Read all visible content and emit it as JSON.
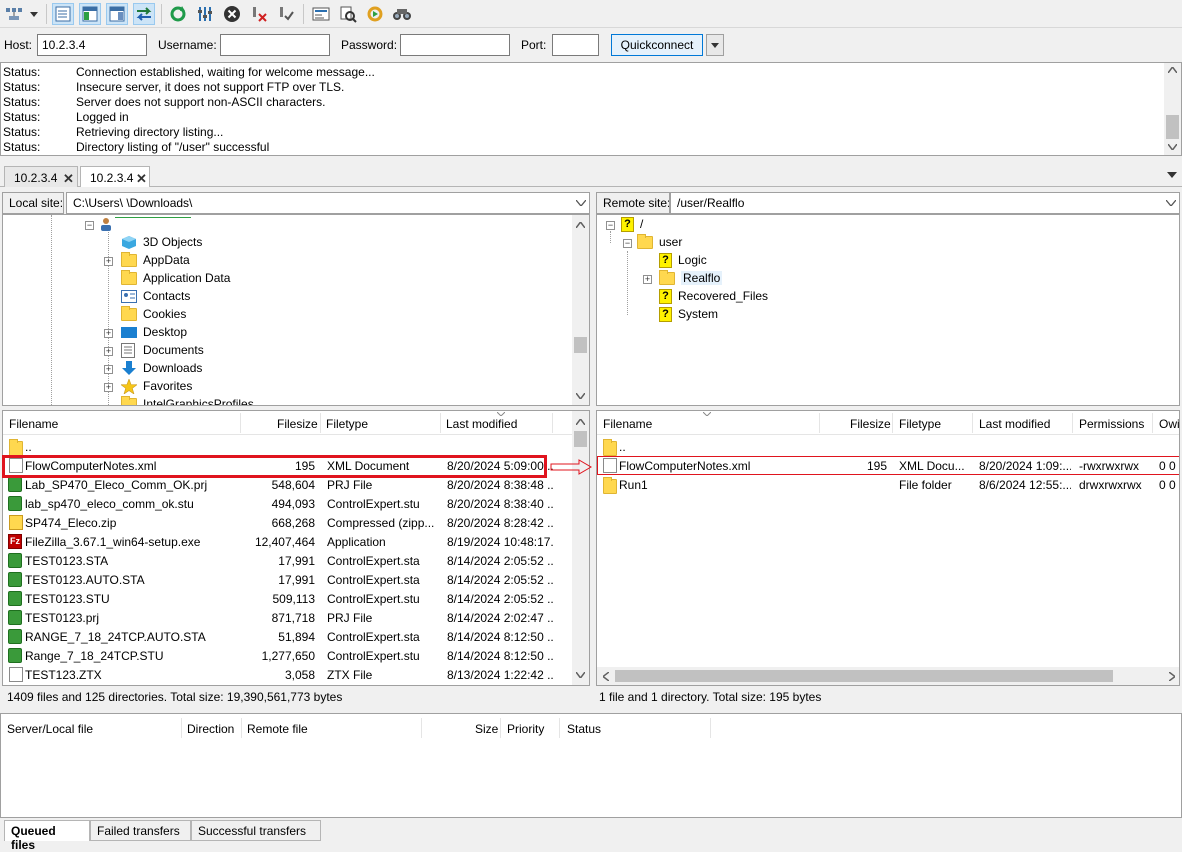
{
  "toolbar": {
    "icons": [
      "site-manager-icon",
      "dropdown-arrow-icon",
      "toggle-message-log-icon",
      "toggle-local-tree-icon",
      "toggle-remote-tree-icon",
      "toggle-transfer-queue-icon",
      "refresh-icon",
      "process-queue-icon",
      "cancel-icon",
      "disconnect-icon",
      "reconnect-icon",
      "directory-filter-icon",
      "compare-icon",
      "sync-browse-icon",
      "search-icon"
    ]
  },
  "quickconnect": {
    "host_label": "Host:",
    "host_value": "10.2.3.4",
    "username_label": "Username:",
    "username_value": "",
    "password_label": "Password:",
    "password_value": "",
    "port_label": "Port:",
    "port_value": "",
    "button_label": "Quickconnect"
  },
  "log": [
    {
      "label": "Status:",
      "text": "Connection established, waiting for welcome message..."
    },
    {
      "label": "Status:",
      "text": "Insecure server, it does not support FTP over TLS."
    },
    {
      "label": "Status:",
      "text": "Server does not support non-ASCII characters."
    },
    {
      "label": "Status:",
      "text": "Logged in"
    },
    {
      "label": "Status:",
      "text": "Retrieving directory listing..."
    },
    {
      "label": "Status:",
      "text": "Directory listing of \"/user\" successful"
    }
  ],
  "tabs": [
    {
      "label": "10.2.3.4"
    },
    {
      "label": "10.2.3.4"
    }
  ],
  "local": {
    "site_label": "Local site:",
    "path": "C:\\Users\\               \\Downloads\\",
    "tree": [
      {
        "label": "3D Objects"
      },
      {
        "label": "AppData"
      },
      {
        "label": "Application Data"
      },
      {
        "label": "Contacts"
      },
      {
        "label": "Cookies"
      },
      {
        "label": "Desktop"
      },
      {
        "label": "Documents"
      },
      {
        "label": "Downloads"
      },
      {
        "label": "Favorites"
      },
      {
        "label": "IntelGraphicsProfiles"
      }
    ],
    "columns": {
      "filename": "Filename",
      "filesize": "Filesize",
      "filetype": "Filetype",
      "modified": "Last modified"
    },
    "files": [
      {
        "name": "..",
        "size": "",
        "type": "",
        "modified": ""
      },
      {
        "name": "FlowComputerNotes.xml",
        "size": "195",
        "type": "XML Document",
        "modified": "8/20/2024 5:09:00 ..."
      },
      {
        "name": "Lab_SP470_Eleco_Comm_OK.prj",
        "size": "548,604",
        "type": "PRJ File",
        "modified": "8/20/2024 8:38:48 ..."
      },
      {
        "name": "lab_sp470_eleco_comm_ok.stu",
        "size": "494,093",
        "type": "ControlExpert.stu",
        "modified": "8/20/2024 8:38:40 ..."
      },
      {
        "name": "SP474_Eleco.zip",
        "size": "668,268",
        "type": "Compressed (zipp...",
        "modified": "8/20/2024 8:28:42 ..."
      },
      {
        "name": "FileZilla_3.67.1_win64-setup.exe",
        "size": "12,407,464",
        "type": "Application",
        "modified": "8/19/2024 10:48:17..."
      },
      {
        "name": "TEST0123.STA",
        "size": "17,991",
        "type": "ControlExpert.sta",
        "modified": "8/14/2024 2:05:52 ..."
      },
      {
        "name": "TEST0123.AUTO.STA",
        "size": "17,991",
        "type": "ControlExpert.sta",
        "modified": "8/14/2024 2:05:52 ..."
      },
      {
        "name": "TEST0123.STU",
        "size": "509,113",
        "type": "ControlExpert.stu",
        "modified": "8/14/2024 2:05:52 ..."
      },
      {
        "name": "TEST0123.prj",
        "size": "871,718",
        "type": "PRJ File",
        "modified": "8/14/2024 2:02:47 ..."
      },
      {
        "name": "RANGE_7_18_24TCP.AUTO.STA",
        "size": "51,894",
        "type": "ControlExpert.sta",
        "modified": "8/14/2024 8:12:50 ..."
      },
      {
        "name": "Range_7_18_24TCP.STU",
        "size": "1,277,650",
        "type": "ControlExpert.stu",
        "modified": "8/14/2024 8:12:50 ..."
      },
      {
        "name": "TEST123.ZTX",
        "size": "3,058",
        "type": "ZTX File",
        "modified": "8/13/2024 1:22:42 ..."
      }
    ],
    "status": "1409 files and 125 directories. Total size: 19,390,561,773 bytes"
  },
  "remote": {
    "site_label": "Remote site:",
    "path": "/user/Realflo",
    "tree": [
      {
        "label": "/"
      },
      {
        "label": "user"
      },
      {
        "label": "Logic"
      },
      {
        "label": "Realflo"
      },
      {
        "label": "Recovered_Files"
      },
      {
        "label": "System"
      }
    ],
    "columns": {
      "filename": "Filename",
      "filesize": "Filesize",
      "filetype": "Filetype",
      "modified": "Last modified",
      "permissions": "Permissions",
      "owner": "Owi"
    },
    "files": [
      {
        "name": "..",
        "size": "",
        "type": "",
        "modified": "",
        "perm": "",
        "owner": ""
      },
      {
        "name": "FlowComputerNotes.xml",
        "size": "195",
        "type": "XML Docu...",
        "modified": "8/20/2024 1:09:...",
        "perm": "-rwxrwxrwx",
        "owner": "0 0"
      },
      {
        "name": "Run1",
        "size": "",
        "type": "File folder",
        "modified": "8/6/2024 12:55:...",
        "perm": "drwxrwxrwx",
        "owner": "0 0"
      }
    ],
    "status": "1 file and 1 directory. Total size: 195 bytes"
  },
  "queue": {
    "columns": {
      "server": "Server/Local file",
      "direction": "Direction",
      "remote": "Remote file",
      "size": "Size",
      "priority": "Priority",
      "status": "Status"
    },
    "tabs": [
      {
        "label": "Queued files"
      },
      {
        "label": "Failed transfers"
      },
      {
        "label": "Successful transfers"
      }
    ]
  },
  "annotation_color": "#e0141e"
}
